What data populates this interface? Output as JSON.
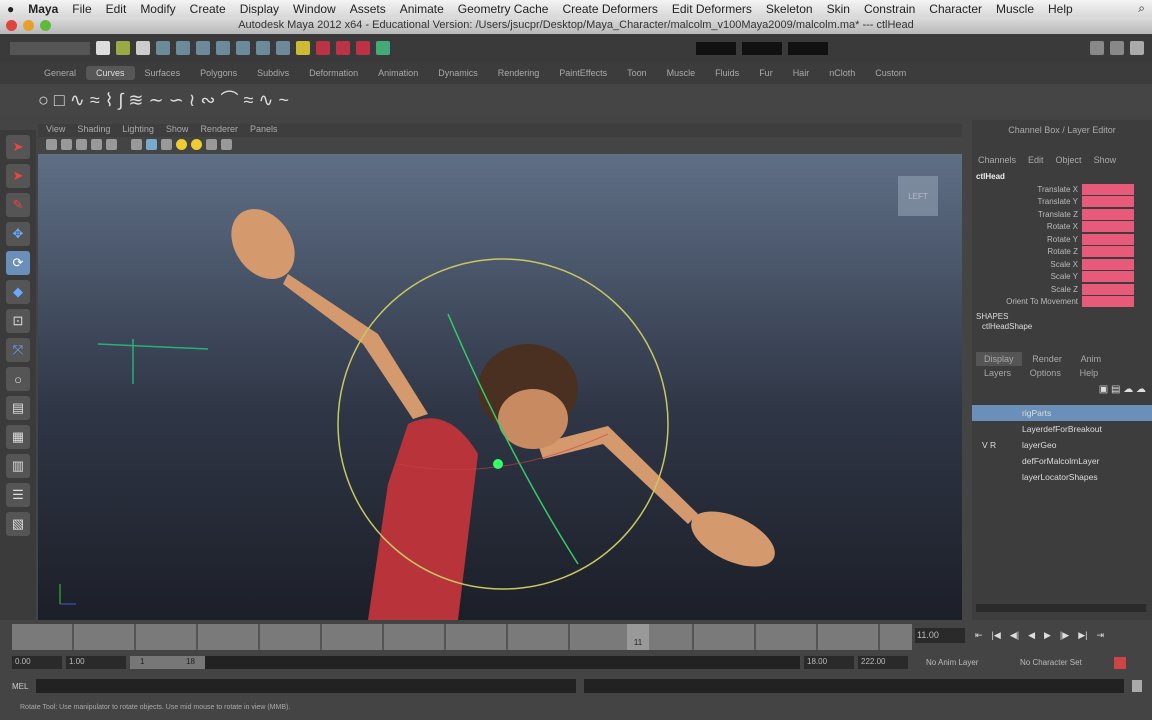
{
  "menubar": {
    "apple": "",
    "items": [
      "Maya",
      "File",
      "Edit",
      "Modify",
      "Create",
      "Display",
      "Window",
      "Assets",
      "Animate",
      "Geometry Cache",
      "Create Deformers",
      "Edit Deformers",
      "Skeleton",
      "Skin",
      "Constrain",
      "Character",
      "Muscle",
      "Help"
    ]
  },
  "window_title": "Autodesk Maya 2012 x64 - Educational Version: /Users/jsucpr/Desktop/Maya_Character/malcolm_v100Maya2009/malcolm.ma* --- ctlHead",
  "shelf_tabs": [
    "General",
    "Curves",
    "Surfaces",
    "Polygons",
    "Subdivs",
    "Deformation",
    "Animation",
    "Dynamics",
    "Rendering",
    "PaintEffects",
    "Toon",
    "Muscle",
    "Fluids",
    "Fur",
    "Hair",
    "nCloth",
    "Custom"
  ],
  "active_shelf": "Curves",
  "shelf_icons": "○ □ ∿ ≈ ⌇ ∫ ≋ ∼ ∽ ≀ ∾ ⌒ ≈ ∿ ~",
  "panel_menu": [
    "View",
    "Shading",
    "Lighting",
    "Show",
    "Renderer",
    "Panels"
  ],
  "viewcube_label": "LEFT",
  "channel_box": {
    "title": "Channel Box / Layer Editor",
    "menus": [
      "Channels",
      "Edit",
      "Object",
      "Show"
    ],
    "object": "ctlHead",
    "attributes": [
      "Translate X",
      "Translate Y",
      "Translate Z",
      "Rotate X",
      "Rotate Y",
      "Rotate Z",
      "Scale X",
      "Scale Y",
      "Scale Z",
      "Orient To Movement"
    ],
    "shapes_label": "SHAPES",
    "shape": "ctlHeadShape",
    "keyed_color": "#e85a7a"
  },
  "layer_editor": {
    "tabs": [
      "Display",
      "Render",
      "Anim"
    ],
    "menus": [
      "Layers",
      "Options",
      "Help"
    ],
    "layers": [
      {
        "name": "rigParts",
        "selected": true
      },
      {
        "name": "LayerdefForBreakout"
      },
      {
        "name": "layerGeo",
        "flags": "V R"
      },
      {
        "name": "defForMalcolmLayer"
      },
      {
        "name": "layerLocatorShapes"
      }
    ]
  },
  "time": {
    "current": "11.00",
    "current_marker": "11",
    "start": "0.00",
    "playback_start": "1.00",
    "range_start": "1",
    "range_end": "18",
    "playback_end": "18.00",
    "end": "222.00",
    "anim_layer": "No Anim Layer",
    "character_set": "No Character Set"
  },
  "playback_buttons": [
    "⇤",
    "|◀",
    "◀|",
    "◀",
    "▶",
    "|▶",
    "▶|",
    "⇥"
  ],
  "command_line": {
    "label": "MEL",
    "value": ""
  },
  "help_line": "Rotate Tool: Use manipulator to rotate objects. Use mid mouse to rotate in view (MMB)."
}
